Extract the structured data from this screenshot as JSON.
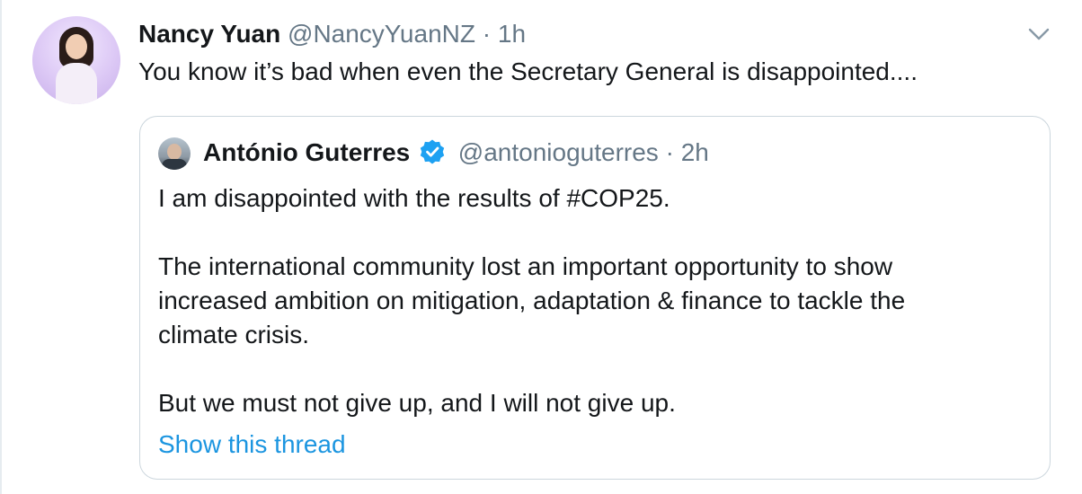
{
  "tweet": {
    "author_name": "Nancy Yuan",
    "author_handle": "@NancyYuanNZ",
    "separator": "·",
    "time": "1h",
    "text": "You know it’s bad when even the Secretary General is disappointed...."
  },
  "quoted_tweet": {
    "author_name": "António Guterres",
    "author_handle": "@antonioguterres",
    "separator": "·",
    "time": "2h",
    "verified": true,
    "lines": {
      "l1": "I am disappointed with the results of #COP25.",
      "l2": "The international community lost an important opportunity to show",
      "l3": "increased ambition on mitigation, adaptation & finance to tackle the",
      "l4": "climate crisis.",
      "l5": "But we must not give up, and I will not give up."
    },
    "show_thread_label": "Show this thread"
  },
  "colors": {
    "text_primary": "#14171a",
    "text_secondary": "#657786",
    "link": "#1b95e0",
    "verified_badge": "#1da1f2",
    "border": "#ccd6dd"
  },
  "icons": {
    "menu": "chevron-down-icon",
    "verified": "verified-badge-icon"
  }
}
